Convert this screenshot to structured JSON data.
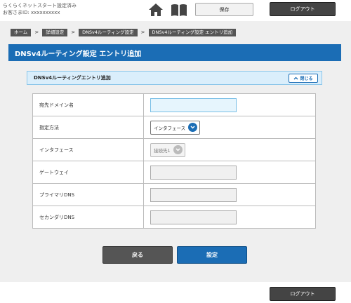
{
  "header": {
    "site_line1": "らくらくネットスタート設定済み",
    "site_line2": "お客さまID: xxxxxxxxxx",
    "save_label": "保存",
    "logout_label": "ログアウト"
  },
  "breadcrumb": [
    "ホーム",
    "詳細設定",
    "DNSv4ルーティング設定",
    "DNSv4ルーティング設定 エントリ追加"
  ],
  "breadcrumb_separator": ">",
  "page_title": "DNSv4ルーティング設定 エントリ追加",
  "section": {
    "title": "DNSv4ルーティングエントリ追加",
    "close_label": "閉じる"
  },
  "form": {
    "rows": [
      {
        "label": "宛先ドメイン名",
        "value": ""
      },
      {
        "label": "指定方法",
        "value": "インタフェース"
      },
      {
        "label": "インタフェース",
        "value": "接続先1"
      },
      {
        "label": "ゲートウェイ",
        "value": ""
      },
      {
        "label": "プライマリDNS",
        "value": ""
      },
      {
        "label": "セカンダリDNS",
        "value": ""
      }
    ]
  },
  "actions": {
    "back_label": "戻る",
    "set_label": "設定"
  },
  "footer": {
    "logout_label": "ログアウト"
  },
  "colors": {
    "brand_blue": "#1b6db5",
    "dark_button": "#444444"
  },
  "icons": [
    "home-icon",
    "book-icon",
    "chevron-up-icon",
    "chevron-down-icon"
  ]
}
